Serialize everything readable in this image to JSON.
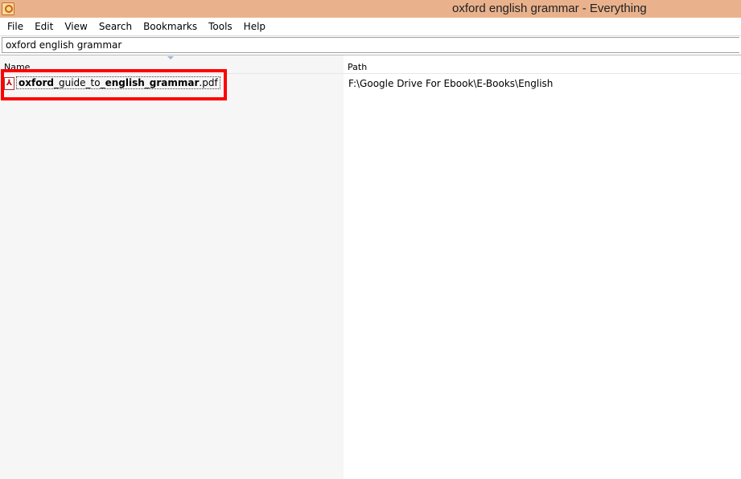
{
  "window": {
    "title": "oxford english grammar - Everything"
  },
  "menu": [
    "File",
    "Edit",
    "View",
    "Search",
    "Bookmarks",
    "Tools",
    "Help"
  ],
  "search": {
    "value": "oxford english grammar"
  },
  "columns": {
    "name": "Name",
    "path": "Path"
  },
  "results": [
    {
      "name_parts": [
        {
          "text": "oxford",
          "bold": true
        },
        {
          "text": "_guide_to_",
          "bold": false
        },
        {
          "text": "english",
          "bold": true
        },
        {
          "text": "_",
          "bold": false
        },
        {
          "text": "grammar",
          "bold": true
        },
        {
          "text": ".pdf",
          "bold": false
        }
      ],
      "path": "F:\\Google Drive For Ebook\\E-Books\\English",
      "icon": "pdf-icon"
    }
  ]
}
